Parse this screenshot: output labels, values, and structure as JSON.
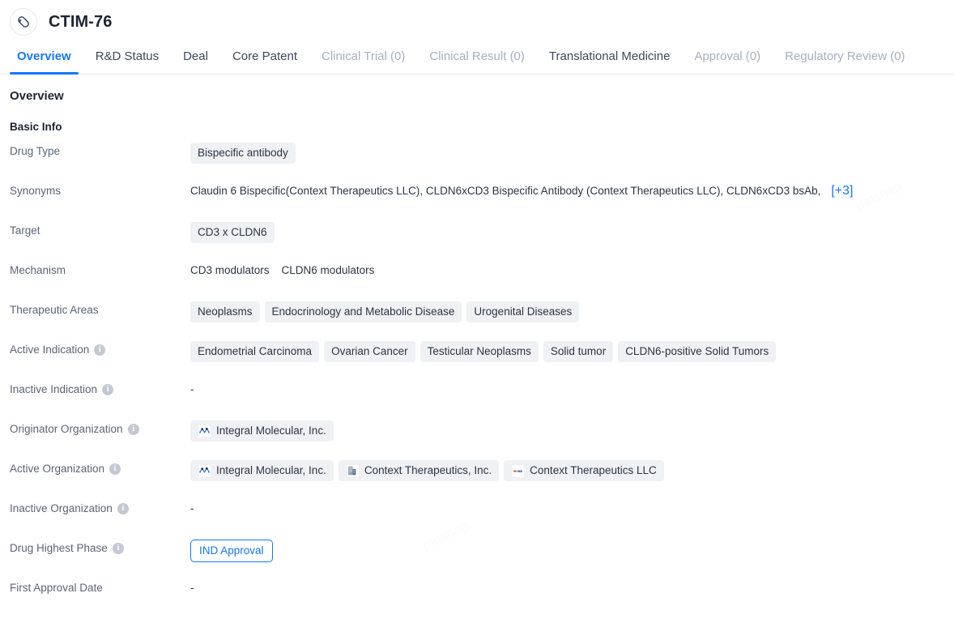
{
  "header": {
    "title": "CTIM-76",
    "avatar_icon": "capsule-pill-icon"
  },
  "tabs": [
    {
      "label": "Overview",
      "state": "active"
    },
    {
      "label": "R&D Status",
      "state": "normal"
    },
    {
      "label": "Deal",
      "state": "normal"
    },
    {
      "label": "Core Patent",
      "state": "normal"
    },
    {
      "label": "Clinical Trial (0)",
      "state": "muted"
    },
    {
      "label": "Clinical Result (0)",
      "state": "muted"
    },
    {
      "label": "Translational Medicine",
      "state": "normal"
    },
    {
      "label": "Approval (0)",
      "state": "muted"
    },
    {
      "label": "Regulatory Review (0)",
      "state": "muted"
    }
  ],
  "overview": {
    "section_title": "Overview",
    "subsection_title": "Basic Info",
    "rows": {
      "drug_type": {
        "label": "Drug Type",
        "chips": [
          "Bispecific antibody"
        ]
      },
      "synonyms": {
        "label": "Synonyms",
        "text": "Claudin 6 Bispecific(Context Therapeutics LLC),  CLDN6xCD3 Bispecific Antibody (Context Therapeutics LLC),  CLDN6xCD3 bsAb,",
        "more": "[+3]"
      },
      "target": {
        "label": "Target",
        "chips": [
          "CD3 x CLDN6"
        ]
      },
      "mechanism": {
        "label": "Mechanism",
        "items": [
          "CD3 modulators",
          "CLDN6 modulators"
        ]
      },
      "therapeutic_areas": {
        "label": "Therapeutic Areas",
        "chips": [
          "Neoplasms",
          "Endocrinology and Metabolic Disease",
          "Urogenital Diseases"
        ]
      },
      "active_indication": {
        "label": "Active Indication",
        "has_info": true,
        "chips": [
          "Endometrial Carcinoma",
          "Ovarian Cancer",
          "Testicular Neoplasms",
          "Solid tumor",
          "CLDN6-positive Solid Tumors"
        ]
      },
      "inactive_indication": {
        "label": "Inactive Indication",
        "has_info": true,
        "value": "-"
      },
      "originator_organization": {
        "label": "Originator Organization",
        "has_info": true,
        "orgs": [
          {
            "name": "Integral Molecular, Inc.",
            "icon": "integral-molecular-logo"
          }
        ]
      },
      "active_organization": {
        "label": "Active Organization",
        "has_info": true,
        "orgs": [
          {
            "name": "Integral Molecular, Inc.",
            "icon": "integral-molecular-logo"
          },
          {
            "name": "Context Therapeutics, Inc.",
            "icon": "building-icon"
          },
          {
            "name": "Context Therapeutics LLC",
            "icon": "context-therapeutics-logo"
          }
        ]
      },
      "inactive_organization": {
        "label": "Inactive Organization",
        "has_info": true,
        "value": "-"
      },
      "drug_highest_phase": {
        "label": "Drug Highest Phase",
        "has_info": true,
        "badge": "IND Approval"
      },
      "first_approval_date": {
        "label": "First Approval Date",
        "value": "-"
      }
    }
  },
  "colors": {
    "accent": "#1677ff",
    "chip_bg": "#f0f1f4",
    "text_primary": "#1d2433",
    "text_label": "#5b6478",
    "muted_tab": "#a7aec0"
  }
}
